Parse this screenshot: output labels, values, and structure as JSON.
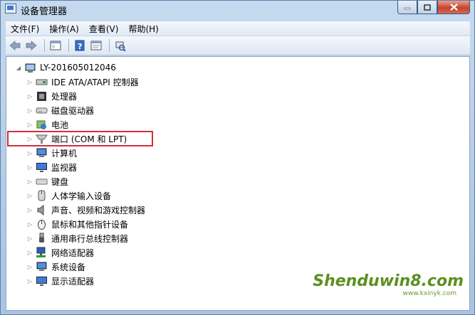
{
  "window": {
    "title": "设备管理器",
    "minimize_icon": "minimize-icon",
    "maximize_icon": "maximize-icon",
    "close_icon": "close-icon"
  },
  "menu": [
    {
      "label": "文件(F)"
    },
    {
      "label": "操作(A)"
    },
    {
      "label": "查看(V)"
    },
    {
      "label": "帮助(H)"
    }
  ],
  "toolbar": {
    "buttons": [
      "back-arrow-icon",
      "forward-arrow-icon",
      "show-hide-tree-icon",
      "help-icon",
      "properties-icon",
      "scan-hardware-icon"
    ]
  },
  "tree": {
    "root": {
      "label": "LY-201605012046",
      "icon": "computer-icon"
    },
    "items": [
      {
        "label": "IDE ATA/ATAPI 控制器",
        "icon": "ide-controller-icon"
      },
      {
        "label": "处理器",
        "icon": "processor-icon"
      },
      {
        "label": "磁盘驱动器",
        "icon": "disk-drive-icon"
      },
      {
        "label": "电池",
        "icon": "battery-icon"
      },
      {
        "label": "端口 (COM 和 LPT)",
        "icon": "port-icon",
        "highlighted": true
      },
      {
        "label": "计算机",
        "icon": "computer-icon"
      },
      {
        "label": "监视器",
        "icon": "monitor-icon"
      },
      {
        "label": "键盘",
        "icon": "keyboard-icon"
      },
      {
        "label": "人体学输入设备",
        "icon": "hid-icon"
      },
      {
        "label": "声音、视频和游戏控制器",
        "icon": "sound-icon"
      },
      {
        "label": "鼠标和其他指针设备",
        "icon": "mouse-icon"
      },
      {
        "label": "通用串行总线控制器",
        "icon": "usb-icon"
      },
      {
        "label": "网络适配器",
        "icon": "network-adapter-icon"
      },
      {
        "label": "系统设备",
        "icon": "system-device-icon"
      },
      {
        "label": "显示适配器",
        "icon": "display-adapter-icon"
      }
    ]
  },
  "colors": {
    "highlight_border": "#d1303c",
    "watermark": "#5c8f1f"
  },
  "watermark": {
    "text": "Shenduwin8.com",
    "subtext": "www.kxinyk.com"
  }
}
